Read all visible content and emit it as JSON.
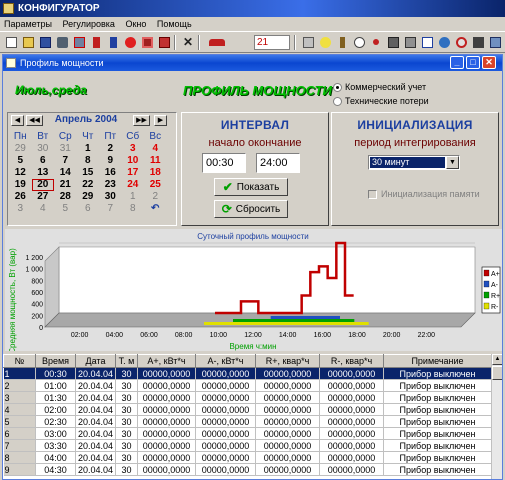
{
  "app": {
    "title": "КОНФИГУРАТОР"
  },
  "menu": [
    "Параметры",
    "Регулировка",
    "Окно",
    "Помощь"
  ],
  "toolbar": {
    "number_field": "21"
  },
  "window": {
    "title": "Профиль мощности"
  },
  "header": {
    "date_label": "Июль,среда",
    "main_title": "ПРОФИЛЬ МОЩНОСТИ",
    "radio_commercial": "Коммерческий учет",
    "radio_technical": "Технические потери"
  },
  "calendar": {
    "month_label": "Апрель 2004",
    "weekdays": [
      "Пн",
      "Вт",
      "Ср",
      "Чт",
      "Пт",
      "Сб",
      "Вс"
    ],
    "weeks": [
      [
        "29",
        "30",
        "31",
        "1",
        "2",
        "3",
        "4"
      ],
      [
        "5",
        "6",
        "7",
        "8",
        "9",
        "10",
        "11"
      ],
      [
        "12",
        "13",
        "14",
        "15",
        "16",
        "17",
        "18"
      ],
      [
        "19",
        "20",
        "21",
        "22",
        "23",
        "24",
        "25"
      ],
      [
        "26",
        "27",
        "28",
        "29",
        "30",
        "1",
        "2"
      ],
      [
        "3",
        "4",
        "5",
        "6",
        "7",
        "8",
        "9"
      ]
    ]
  },
  "interval": {
    "title": "ИНТЕРВАЛ",
    "subtitle": "начало окончание",
    "start": "00:30",
    "end": "24:00",
    "show_button": "Показать",
    "reset_button": "Сбросить"
  },
  "init": {
    "title": "ИНИЦИАЛИЗАЦИЯ",
    "subtitle": "период интегрирования",
    "period_value": "30 минут",
    "memory_checkbox": "Инициализация памяти"
  },
  "chart_data": {
    "type": "bar",
    "title": "Суточный профиль мощности",
    "xlabel": "Время ч:мин",
    "ylabel": "Средняя мощность, Вт (вар)",
    "ylim": [
      0,
      1200
    ],
    "yticks": [
      "0",
      "200",
      "400",
      "600",
      "800",
      "1 000",
      "1 200"
    ],
    "xticks": [
      "02:00",
      "04:00",
      "06:00",
      "08:00",
      "10:00",
      "12:00",
      "14:00",
      "16:00",
      "18:00",
      "20:00",
      "22:00"
    ],
    "legend": [
      "A+",
      "A-",
      "R+",
      "R-"
    ],
    "series_colors": {
      "A+": "#c00000",
      "A-": "#2050c0",
      "R+": "#00a000",
      "R-": "#e0e000"
    },
    "categories": [
      "09:00",
      "09:30",
      "10:00",
      "10:30",
      "11:00",
      "11:30",
      "12:00",
      "12:30",
      "13:00",
      "13:30",
      "14:00",
      "14:30",
      "15:00",
      "15:30",
      "16:00",
      "16:30"
    ],
    "series": [
      {
        "name": "A+",
        "values": [
          0,
          0,
          0,
          200,
          200,
          0,
          0,
          0,
          0,
          0,
          300,
          700,
          800,
          600,
          1200,
          300
        ]
      }
    ]
  },
  "table": {
    "columns": [
      "№",
      "Время",
      "Дата",
      "Т. м",
      "A+, кВт*ч",
      "A-, кВт*ч",
      "R+, квар*ч",
      "R-, квар*ч",
      "Примечание"
    ],
    "rows": [
      [
        "1",
        "00:30",
        "20.04.04",
        "30",
        "00000,0000",
        "00000,0000",
        "00000,0000",
        "00000,0000",
        "Прибор выключен"
      ],
      [
        "2",
        "01:00",
        "20.04.04",
        "30",
        "00000,0000",
        "00000,0000",
        "00000,0000",
        "00000,0000",
        "Прибор выключен"
      ],
      [
        "3",
        "01:30",
        "20.04.04",
        "30",
        "00000,0000",
        "00000,0000",
        "00000,0000",
        "00000,0000",
        "Прибор выключен"
      ],
      [
        "4",
        "02:00",
        "20.04.04",
        "30",
        "00000,0000",
        "00000,0000",
        "00000,0000",
        "00000,0000",
        "Прибор выключен"
      ],
      [
        "5",
        "02:30",
        "20.04.04",
        "30",
        "00000,0000",
        "00000,0000",
        "00000,0000",
        "00000,0000",
        "Прибор выключен"
      ],
      [
        "6",
        "03:00",
        "20.04.04",
        "30",
        "00000,0000",
        "00000,0000",
        "00000,0000",
        "00000,0000",
        "Прибор выключен"
      ],
      [
        "7",
        "03:30",
        "20.04.04",
        "30",
        "00000,0000",
        "00000,0000",
        "00000,0000",
        "00000,0000",
        "Прибор выключен"
      ],
      [
        "8",
        "04:00",
        "20.04.04",
        "30",
        "00000,0000",
        "00000,0000",
        "00000,0000",
        "00000,0000",
        "Прибор выключен"
      ],
      [
        "9",
        "04:30",
        "20.04.04",
        "30",
        "00000,0000",
        "00000,0000",
        "00000,0000",
        "00000,0000",
        "Прибор выключен"
      ]
    ]
  }
}
